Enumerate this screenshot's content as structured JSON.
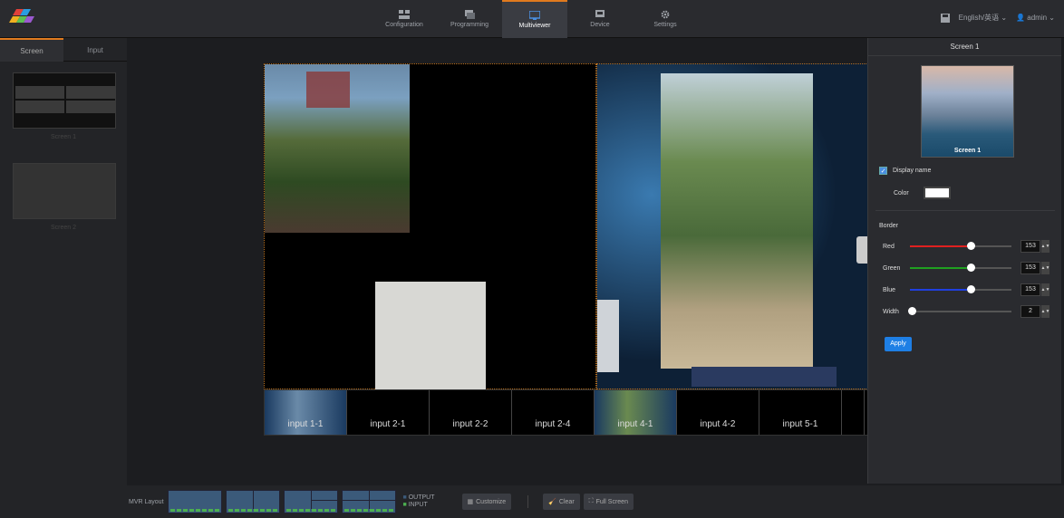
{
  "nav": {
    "items": [
      {
        "label": "Configuration",
        "icon": "grid-icon"
      },
      {
        "label": "Programming",
        "icon": "layers-icon"
      },
      {
        "label": "Multiviewer",
        "icon": "monitor-icon",
        "active": true
      },
      {
        "label": "Device",
        "icon": "device-icon"
      },
      {
        "label": "Settings",
        "icon": "gear-icon"
      }
    ],
    "language": "English/英语",
    "user": "admin"
  },
  "sidebar": {
    "tabs": [
      "Screen",
      "Input"
    ],
    "screens": [
      "Screen 1",
      "Screen 2"
    ]
  },
  "inputs": [
    "input 1-1",
    "input 2-1",
    "input 2-2",
    "input 2-4",
    "input 4-1",
    "input 4-2",
    "input 5-1"
  ],
  "panel": {
    "title": "Screen 1",
    "preview_label": "Screen 1",
    "display_name_label": "Display name",
    "display_name_checked": true,
    "color_label": "Color",
    "color_value": "#ffffff",
    "border_label": "Border",
    "sliders": [
      {
        "label": "Red",
        "value": "153",
        "color": "#e02020",
        "fraction": 0.6
      },
      {
        "label": "Green",
        "value": "153",
        "color": "#20a020",
        "fraction": 0.6
      },
      {
        "label": "Blue",
        "value": "153",
        "color": "#2040e0",
        "fraction": 0.6
      },
      {
        "label": "Width",
        "value": "2",
        "color": "#555555",
        "fraction": 0.02
      }
    ],
    "apply_label": "Apply"
  },
  "bottom": {
    "layout_label": "MVR Layout",
    "legend_output": "OUTPUT",
    "legend_input": "INPUT",
    "customize": "Customize",
    "clear": "Clear",
    "fullscreen": "Full Screen"
  }
}
